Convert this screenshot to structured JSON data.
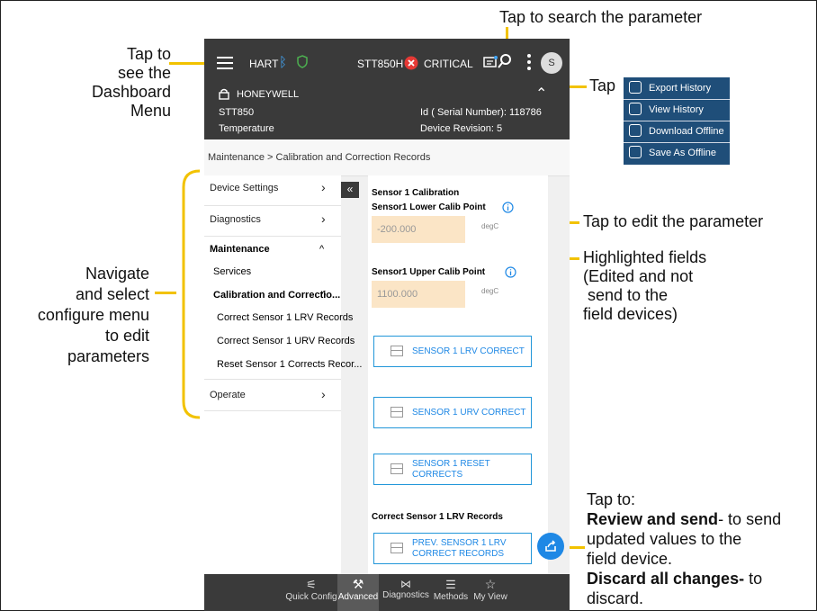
{
  "annotations": {
    "search_hint": "Tap to search the parameter",
    "dashboard_hint": [
      "Tap to",
      "see the",
      "Dashboard",
      "Menu"
    ],
    "menu_hint": "Tap",
    "edit_hint": "Tap to edit the parameter",
    "highlight_hint": [
      "Highlighted fields",
      "(Edited and not",
      " send to the",
      "field devices)"
    ],
    "navigate_hint": [
      "Navigate",
      "and select",
      "configure menu",
      "to edit",
      "parameters"
    ],
    "send_hint": {
      "line1": "Tap to:",
      "bold1": "Review and send",
      "rest1": "- to send",
      "line3": "updated values to the",
      "line4": "field device.",
      "bold2": "Discard all changes-",
      "rest2": " to",
      "line6": "discard."
    }
  },
  "popup_menu": [
    "Export History",
    "View History",
    "Download Offline",
    "Save As Offline"
  ],
  "topbar": {
    "protocol": "HART",
    "device": "STT850H",
    "status": "CRITICAL",
    "avatar": "S"
  },
  "device": {
    "brand": "HONEYWELL",
    "model": "STT850",
    "type": "Temperature",
    "serial": "Id ( Serial Number): 118786",
    "revision": "Device Revision: 5"
  },
  "breadcrumb": "Maintenance > Calibration and Correction Records",
  "sidebar": {
    "device_settings": "Device Settings",
    "diagnostics": "Diagnostics",
    "maintenance": "Maintenance",
    "services": "Services",
    "calib": "Calibration and Correctio...",
    "lrv": "Correct Sensor 1 LRV Records",
    "urv": "Correct Sensor 1 URV Records",
    "reset": "Reset Sensor 1 Corrects Recor...",
    "operate": "Operate"
  },
  "content": {
    "section": "Sensor 1 Calibration",
    "lower_label": "Sensor1 Lower Calib Point",
    "lower_value": "-200.000",
    "upper_label": "Sensor1 Upper Calib Point",
    "upper_value": "1100.000",
    "unit": "degC",
    "btn_lrv": "SENSOR 1 LRV CORRECT",
    "btn_urv": "SENSOR 1 URV CORRECT",
    "btn_reset": [
      "SENSOR 1 RESET",
      "CORRECTS"
    ],
    "records_title": "Correct Sensor 1 LRV Records",
    "btn_prev": [
      "PREV. SENSOR 1 LRV",
      "CORRECT RECORDS"
    ]
  },
  "bottom_nav": [
    "Quick Config",
    "Advanced",
    "Diagnostics",
    "Methods",
    "My View"
  ]
}
